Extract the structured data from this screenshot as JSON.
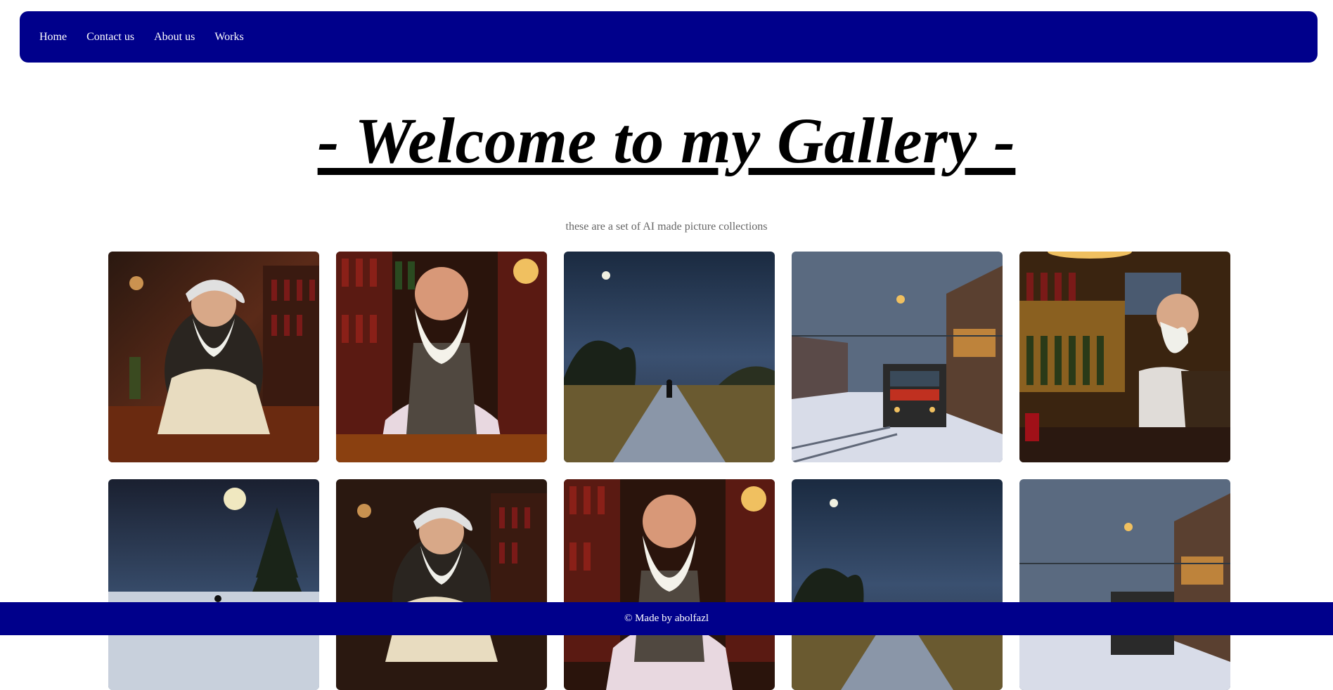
{
  "nav": {
    "items": [
      {
        "label": "Home"
      },
      {
        "label": "Contact us"
      },
      {
        "label": "About us"
      },
      {
        "label": "Works"
      }
    ]
  },
  "header": {
    "title": "- Welcome to my Gallery -",
    "subtitle": "these are a set of AI made picture collections"
  },
  "gallery": {
    "images": [
      {
        "subject": "old-bartender-painting"
      },
      {
        "subject": "old-bartender-front-painting"
      },
      {
        "subject": "night-road-painting"
      },
      {
        "subject": "snowy-train-station-painting"
      },
      {
        "subject": "old-man-bar-profile-painting"
      },
      {
        "subject": "moonlit-snow-forest-painting"
      },
      {
        "subject": "old-bartender-painting"
      },
      {
        "subject": "old-bartender-front-painting"
      },
      {
        "subject": "night-road-painting"
      },
      {
        "subject": "snowy-train-station-painting"
      }
    ]
  },
  "footer": {
    "text": "© Made by abolfazl"
  },
  "colors": {
    "navbar": "#00008b",
    "footer": "#00008b",
    "subtitle": "#666666"
  }
}
